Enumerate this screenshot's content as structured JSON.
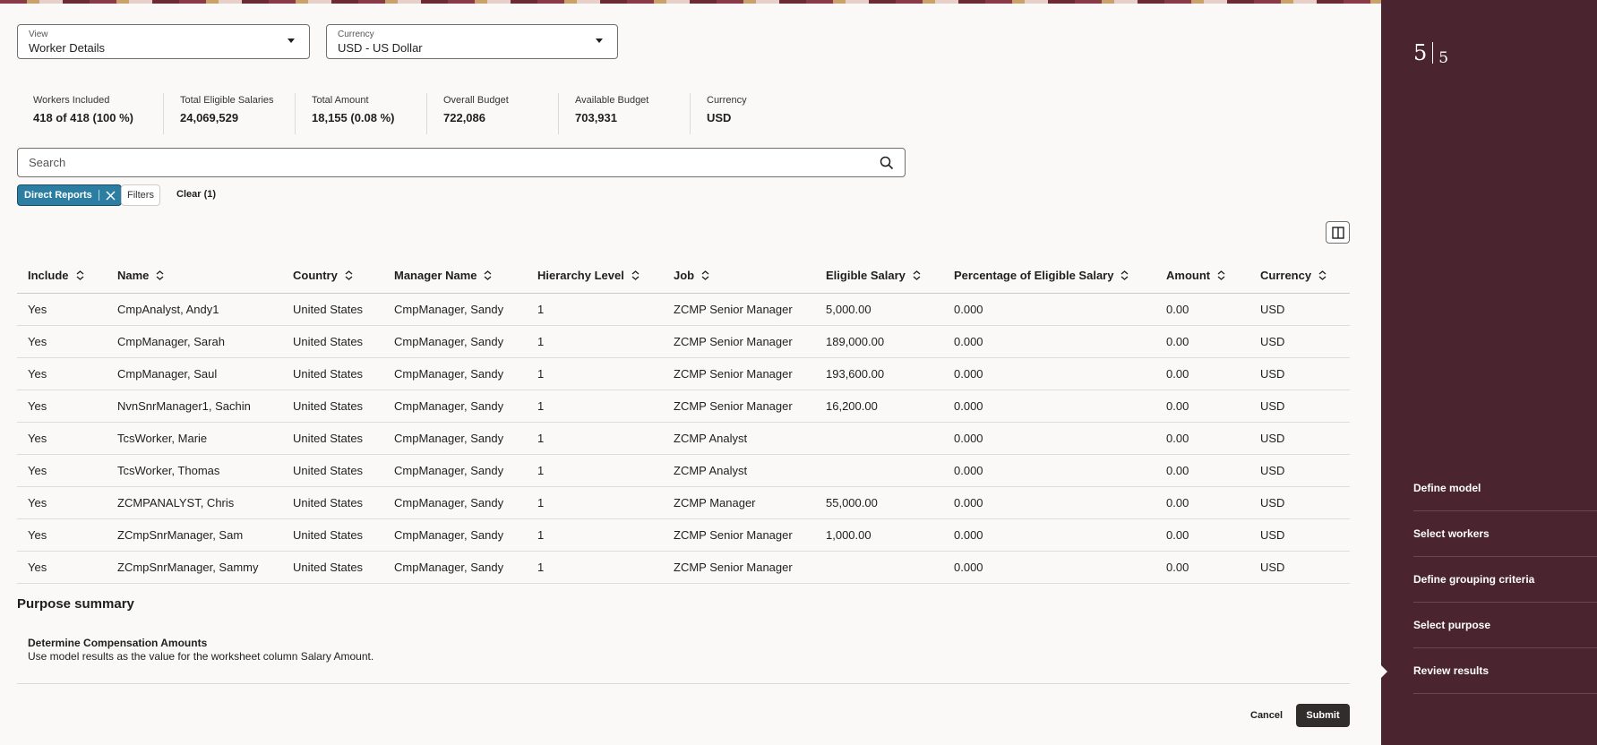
{
  "view_select": {
    "label": "View",
    "value": "Worker Details"
  },
  "currency_select": {
    "label": "Currency",
    "value": "USD - US Dollar"
  },
  "metrics": [
    {
      "label": "Workers Included",
      "value": "418 of 418 (100 %)"
    },
    {
      "label": "Total Eligible Salaries",
      "value": "24,069,529"
    },
    {
      "label": "Total Amount",
      "value": "18,155 (0.08 %)"
    },
    {
      "label": "Overall Budget",
      "value": "722,086"
    },
    {
      "label": "Available Budget",
      "value": "703,931"
    },
    {
      "label": "Currency",
      "value": "USD"
    }
  ],
  "search": {
    "placeholder": "Search",
    "icon": "search-icon"
  },
  "filter_bar": {
    "chip_label": "Direct Reports",
    "filters_label": "Filters",
    "clear_label": "Clear (1)"
  },
  "table": {
    "headers": [
      "Include",
      "Name",
      "Country",
      "Manager Name",
      "Hierarchy Level",
      "Job",
      "Eligible Salary",
      "Percentage of Eligible Salary",
      "Amount",
      "Currency"
    ],
    "rows": [
      [
        "Yes",
        "CmpAnalyst, Andy1",
        "United States",
        "CmpManager, Sandy",
        "1",
        "ZCMP Senior Manager",
        "5,000.00",
        "0.000",
        "0.00",
        "USD"
      ],
      [
        "Yes",
        "CmpManager, Sarah",
        "United States",
        "CmpManager, Sandy",
        "1",
        "ZCMP Senior Manager",
        "189,000.00",
        "0.000",
        "0.00",
        "USD"
      ],
      [
        "Yes",
        "CmpManager, Saul",
        "United States",
        "CmpManager, Sandy",
        "1",
        "ZCMP Senior Manager",
        "193,600.00",
        "0.000",
        "0.00",
        "USD"
      ],
      [
        "Yes",
        "NvnSnrManager1, Sachin",
        "United States",
        "CmpManager, Sandy",
        "1",
        "ZCMP Senior Manager",
        "16,200.00",
        "0.000",
        "0.00",
        "USD"
      ],
      [
        "Yes",
        "TcsWorker, Marie",
        "United States",
        "CmpManager, Sandy",
        "1",
        "ZCMP Analyst",
        "",
        "0.000",
        "0.00",
        "USD"
      ],
      [
        "Yes",
        "TcsWorker, Thomas",
        "United States",
        "CmpManager, Sandy",
        "1",
        "ZCMP Analyst",
        "",
        "0.000",
        "0.00",
        "USD"
      ],
      [
        "Yes",
        "ZCMPANALYST, Chris",
        "United States",
        "CmpManager, Sandy",
        "1",
        "ZCMP Manager",
        "55,000.00",
        "0.000",
        "0.00",
        "USD"
      ],
      [
        "Yes",
        "ZCmpSnrManager, Sam",
        "United States",
        "CmpManager, Sandy",
        "1",
        "ZCMP Senior Manager",
        "1,000.00",
        "0.000",
        "0.00",
        "USD"
      ],
      [
        "Yes",
        "ZCmpSnrManager, Sammy",
        "United States",
        "CmpManager, Sandy",
        "1",
        "ZCMP Senior Manager",
        "",
        "0.000",
        "0.00",
        "USD"
      ]
    ]
  },
  "purpose": {
    "title": "Purpose summary",
    "name": "Determine Compensation Amounts",
    "description": "Use model results as the value for the worksheet column Salary Amount."
  },
  "actions": {
    "cancel": "Cancel",
    "submit": "Submit"
  },
  "sidebar": {
    "current_step": "5",
    "total_steps": "5",
    "steps": [
      "Define model",
      "Select workers",
      "Define grouping criteria",
      "Select purpose",
      "Review results"
    ]
  },
  "colors": {
    "chip": "#2b7da1",
    "sidebar": "#4a2530",
    "submit": "#312d2a"
  }
}
